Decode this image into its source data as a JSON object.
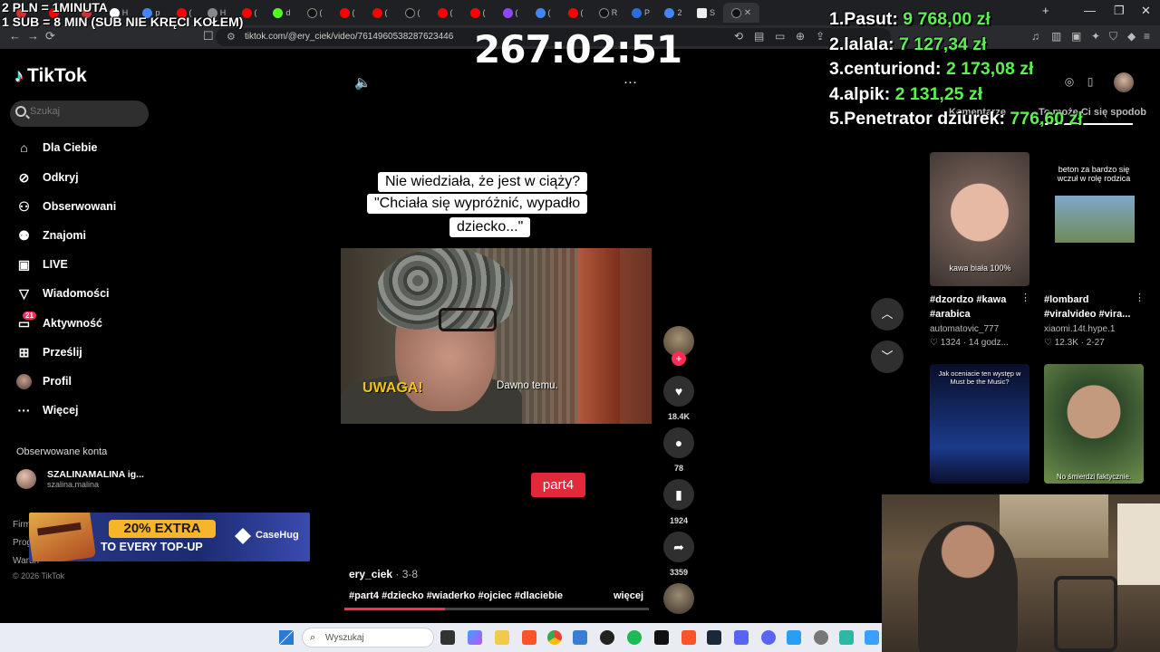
{
  "browser": {
    "tab_labels": [
      "H",
      "p",
      "(",
      "H",
      "(",
      "(",
      "d",
      "(",
      "(",
      "(",
      "(",
      "(",
      "(",
      "(",
      "(",
      "R",
      "P",
      "2",
      "S"
    ],
    "url": "tiktok.com/@ery_ciek/video/7614960538287623446",
    "close_glyph": "✕",
    "new_tab_glyph": "+",
    "win_min": "—",
    "win_max": "❐",
    "win_close": "✕"
  },
  "stream": {
    "top_line1": "2 PLN = 1MINUTA",
    "top_line2": "1 SUB = 8 MIN (SUB NIE KRĘCI KOŁEM)",
    "timer": "267:02:51",
    "leaderboard": [
      {
        "rank": "1.",
        "name": "Pasut:",
        "amount": "9 768,00 zł"
      },
      {
        "rank": "2.",
        "name": "lalala:",
        "amount": "7 127,34 zł"
      },
      {
        "rank": "3.",
        "name": "centuriond:",
        "amount": "2 173,08 zł"
      },
      {
        "rank": "4.",
        "name": "alpik:",
        "amount": "2 131,25 zł"
      },
      {
        "rank": "5.",
        "name": "Penetrator dziurek:",
        "amount": "776,60 zł"
      }
    ]
  },
  "tiktok": {
    "logo": "TikTok",
    "search_placeholder": "Szukaj",
    "nav": [
      {
        "label": "Dla Ciebie",
        "icon": "home-icon"
      },
      {
        "label": "Odkryj",
        "icon": "compass-icon"
      },
      {
        "label": "Obserwowani",
        "icon": "following-icon"
      },
      {
        "label": "Znajomi",
        "icon": "friends-icon"
      },
      {
        "label": "LIVE",
        "icon": "live-icon"
      },
      {
        "label": "Wiadomości",
        "icon": "messages-icon"
      },
      {
        "label": "Aktywność",
        "icon": "activity-icon"
      },
      {
        "label": "Prześlij",
        "icon": "upload-icon"
      },
      {
        "label": "Profil",
        "icon": "profile-icon"
      },
      {
        "label": "Więcej",
        "icon": "more-icon"
      }
    ],
    "activity_badge": "21",
    "followed_title": "Obserwowane konta",
    "followed": {
      "name": "SZALINAMALINA ig...",
      "handle": "szalina.malina"
    },
    "footer": [
      "Firm",
      "Prog",
      "Warun"
    ],
    "copyright": "© 2026 TikTok"
  },
  "ad": {
    "headline": "20% EXTRA",
    "subline": "TO EVERY TOP-UP",
    "brand": "CaseHug"
  },
  "video": {
    "caption_lines": [
      "Nie wiedziała, że jest w ciąży?",
      "\"Chciała się wypróżnić, wypadło",
      "dziecko...\""
    ],
    "burned_text": "UWAGA!",
    "subtitle": "Dawno temu.",
    "part_tag": "part4",
    "author": "ery_ciek",
    "date": " · 3-8",
    "hashtags": "#part4 #dziecko #wiaderko #ojciec #dlaciebie",
    "more": "więcej",
    "progress": 0.33,
    "likes": "18.4K",
    "comments": "78",
    "saves": "1924",
    "shares": "3359",
    "follow_plus": "+"
  },
  "right_panel": {
    "tab_comments": "Komentarze",
    "tab_suggested": "To może Ci się spodob",
    "cards": [
      {
        "thumb_text": "kawa biała 100%",
        "title": "#dzordzo #kawa #arabica",
        "author": "automatovic_777",
        "likes": "1324",
        "time": " · 14 godz..."
      },
      {
        "thumb_text": "beton za bardzo się wczuł w rolę rodzica",
        "title": "#lombard #viralvideo #vira...",
        "author": "xiaomi.14t.hype.1",
        "likes": "12.3K",
        "time": " · 2-27"
      },
      {
        "thumb_text": "Jak oceniacie ten występ w Must be the Music?",
        "title": "",
        "author": "",
        "likes": "",
        "time": ""
      },
      {
        "thumb_text": "No śmierdzi faktycznie.",
        "title": "",
        "author": "",
        "likes": "",
        "time": ""
      }
    ]
  },
  "taskbar": {
    "search_placeholder": "Wyszukaj"
  },
  "colors": {
    "accent": "#fe2c55",
    "leaderboard_amount": "#5cf04f",
    "part_tag": "#e2283b"
  }
}
